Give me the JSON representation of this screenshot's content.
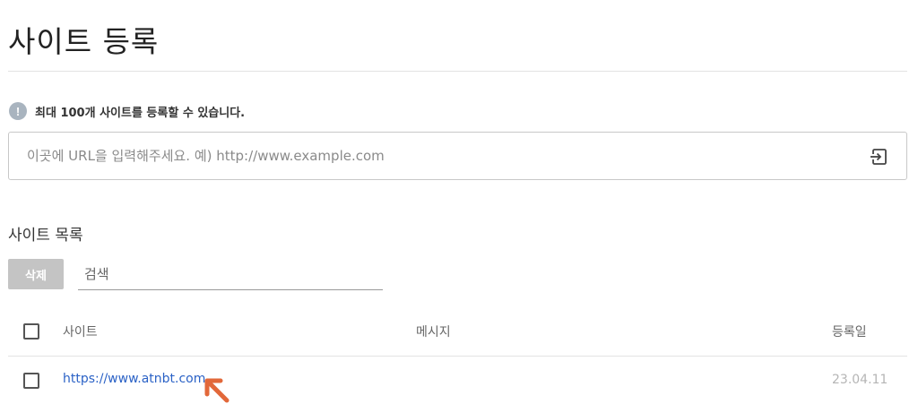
{
  "page": {
    "title": "사이트 등록"
  },
  "notice": {
    "icon": "info-exclamation-icon",
    "text": "최대 100개 사이트를 등록할 수 있습니다."
  },
  "url_input": {
    "value": "",
    "placeholder": "이곳에 URL을 입력해주세요. 예) http://www.example.com",
    "submit_icon": "enter-arrow-icon"
  },
  "site_list": {
    "title": "사이트 목록",
    "delete_label": "삭제",
    "search": {
      "value": "",
      "placeholder": "검색"
    },
    "columns": {
      "site": "사이트",
      "message": "메시지",
      "date": "등록일"
    },
    "rows": [
      {
        "checked": false,
        "site": "https://www.atnbt.com",
        "message": "",
        "date": "23.04.11"
      }
    ]
  },
  "colors": {
    "link": "#2b62c6",
    "annotation_arrow": "#e2683a",
    "delete_button": "#c4c4c4",
    "info_icon": "#a9b4bf"
  }
}
